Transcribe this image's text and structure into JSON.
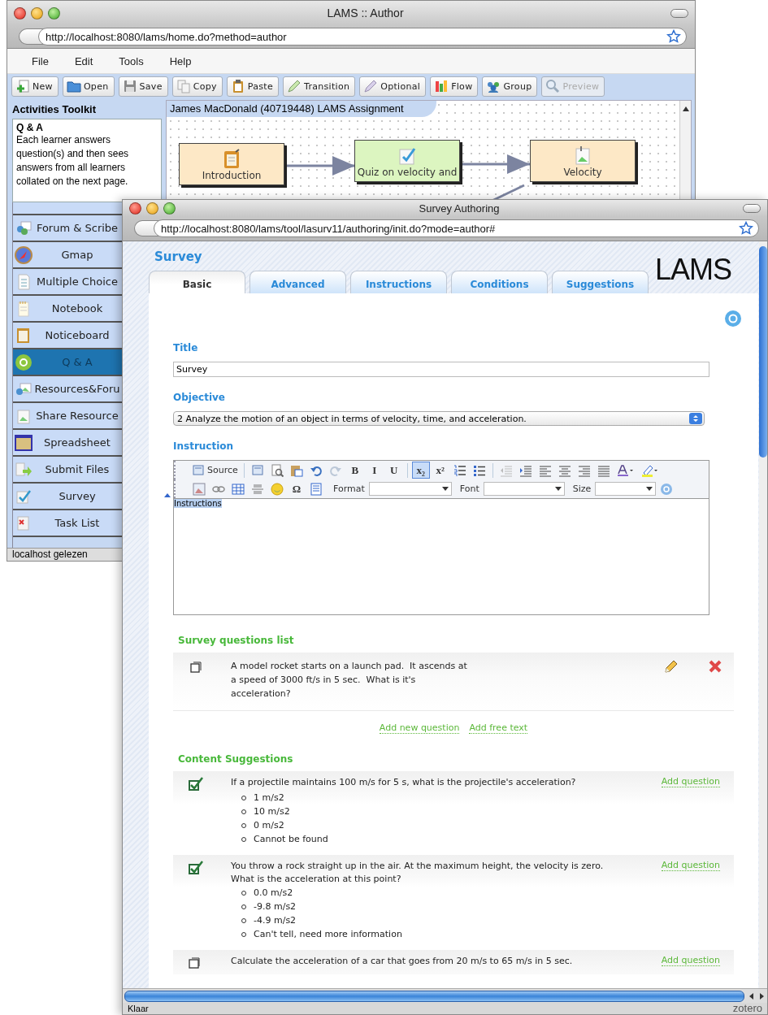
{
  "author_window": {
    "title": "LAMS :: Author",
    "url": "http://localhost:8080/lams/home.do?method=author",
    "menu": [
      "File",
      "Edit",
      "Tools",
      "Help"
    ],
    "toolbar": [
      {
        "label": "New",
        "disabled": false
      },
      {
        "label": "Open",
        "disabled": false
      },
      {
        "label": "Save",
        "disabled": false
      },
      {
        "label": "Copy",
        "disabled": false
      },
      {
        "label": "Paste",
        "disabled": false
      },
      {
        "label": "Transition",
        "disabled": false
      },
      {
        "label": "Optional",
        "disabled": false
      },
      {
        "label": "Flow",
        "disabled": false
      },
      {
        "label": "Group",
        "disabled": false
      },
      {
        "label": "Preview",
        "disabled": true
      }
    ],
    "toolkit": {
      "title": "Activities Toolkit",
      "info_title": "Q & A",
      "info_text": "Each learner answers question(s) and then sees answers from all learners collated on the next page.",
      "items": [
        {
          "label": "Forum & Scribe",
          "selected": false
        },
        {
          "label": "Gmap",
          "selected": false
        },
        {
          "label": "Multiple Choice",
          "selected": false
        },
        {
          "label": "Notebook",
          "selected": false
        },
        {
          "label": "Noticeboard",
          "selected": false
        },
        {
          "label": "Q & A",
          "selected": true
        },
        {
          "label": "Resources&Foru",
          "selected": false
        },
        {
          "label": "Share Resource",
          "selected": false
        },
        {
          "label": "Spreadsheet",
          "selected": false
        },
        {
          "label": "Submit Files",
          "selected": false
        },
        {
          "label": "Survey",
          "selected": false
        },
        {
          "label": "Task List",
          "selected": false
        }
      ]
    },
    "canvas": {
      "title": "James MacDonald (40719448) LAMS Assignment",
      "activities": [
        {
          "label": "Introduction",
          "kind": "notice"
        },
        {
          "label": "Quiz on velocity and",
          "kind": "quiz"
        },
        {
          "label": "Velocity",
          "kind": "resource"
        }
      ]
    },
    "status_bar": "localhost gelezen"
  },
  "survey_window": {
    "title": "Survey Authoring",
    "url": "http://localhost:8080/lams/tool/lasurv11/authoring/init.do?mode=author#",
    "heading": "Survey",
    "logo": "LAMS",
    "tabs": [
      {
        "label": "Basic",
        "selected": true
      },
      {
        "label": "Advanced",
        "selected": false
      },
      {
        "label": "Instructions",
        "selected": false
      },
      {
        "label": "Conditions",
        "selected": false
      },
      {
        "label": "Suggestions",
        "selected": false
      }
    ],
    "title_label": "Title",
    "title_value": "Survey",
    "objective_label": "Objective",
    "objective_value": "2 Analyze the motion of an object in terms of velocity, time, and acceleration.",
    "instruction_label": "Instruction",
    "editor": {
      "rows": [
        [
          {
            "kind": "button",
            "label": "Source"
          },
          {
            "kind": "sep"
          },
          {
            "kind": "icon"
          },
          {
            "kind": "icon"
          },
          {
            "kind": "icon"
          },
          {
            "kind": "icon"
          },
          {
            "kind": "icon"
          },
          {
            "kind": "glyph",
            "label": "B",
            "pressed": false
          },
          {
            "kind": "glyph",
            "label": "I",
            "pressed": false
          },
          {
            "kind": "glyph",
            "label": "U",
            "pressed": false
          },
          {
            "kind": "sep"
          },
          {
            "kind": "glyph",
            "label": "x₂",
            "pressed": true
          },
          {
            "kind": "glyph",
            "label": "x²",
            "pressed": false
          },
          {
            "kind": "icon"
          },
          {
            "kind": "icon"
          },
          {
            "kind": "sep"
          },
          {
            "kind": "icon"
          },
          {
            "kind": "icon"
          },
          {
            "kind": "icon"
          },
          {
            "kind": "icon"
          },
          {
            "kind": "icon"
          },
          {
            "kind": "icon"
          },
          {
            "kind": "icon"
          },
          {
            "kind": "icon"
          }
        ],
        [
          {
            "kind": "icon"
          },
          {
            "kind": "icon"
          },
          {
            "kind": "icon"
          },
          {
            "kind": "icon"
          },
          {
            "kind": "icon"
          },
          {
            "kind": "glyph",
            "label": "Ω",
            "pressed": false
          },
          {
            "kind": "icon"
          },
          {
            "kind": "combo",
            "label": "Format"
          },
          {
            "kind": "combo",
            "label": "Font"
          },
          {
            "kind": "combo",
            "label": "Size"
          },
          {
            "kind": "icon"
          }
        ]
      ],
      "content": "Instructions",
      "content_selected": true
    },
    "questions_title": "Survey questions list",
    "questions": [
      {
        "text": "A model rocket starts on a launch pad.  It ascends at a speed of 3000 ft/s in 5 sec.  What is it's acceleration?"
      }
    ],
    "question_links": [
      "Add new question",
      "Add free text"
    ],
    "suggestions_title": "Content Suggestions",
    "suggestions": [
      {
        "kind": "choice",
        "text": "If a projectile maintains 100 m/s for 5 s, what is the projectile's acceleration?",
        "action": "Add question",
        "options": [
          "1 m/s2",
          "10 m/s2",
          "0 m/s2",
          "Cannot be found"
        ]
      },
      {
        "kind": "choice",
        "text": "You throw a rock straight up in the air. At the maximum height, the velocity is zero. What is the acceleration at this point?",
        "action": "Add question",
        "options": [
          "0.0 m/s2",
          "-9.8 m/s2",
          "-4.9 m/s2",
          "Can't tell, need more information"
        ]
      },
      {
        "kind": "text",
        "text": "Calculate the acceleration of a car that goes from 20 m/s to 65 m/s in 5 sec.",
        "action": "Add question"
      }
    ],
    "status_left": "Klaar",
    "status_right": "zotero"
  }
}
